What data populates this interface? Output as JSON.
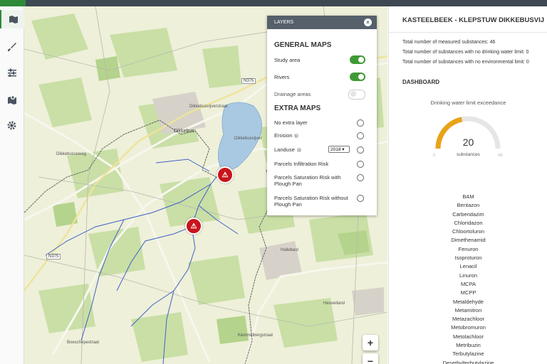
{
  "sidebar": {
    "items": [
      "map-icon",
      "brush-icon",
      "sliders-icon",
      "map-marker-icon",
      "gear-icon"
    ]
  },
  "map": {
    "labels": {
      "village": "Dikkebus",
      "road1": "Dikkebusvijverstraat",
      "road2": "N375",
      "road3": "N375",
      "lake": "Dikkebusvijver",
      "road4": "Heuvelland",
      "road5": "Kemmelbergstraat",
      "road6": "Boeschepestraat",
      "road7": "Hallebast",
      "road8": "Dikkebusseweg"
    },
    "zoom": {
      "in": "+",
      "out": "−"
    }
  },
  "layers": {
    "header": "LAYERS",
    "close": "×",
    "general_title": "GENERAL MAPS",
    "general": [
      {
        "label": "Study area",
        "on": true
      },
      {
        "label": "Rivers",
        "on": true
      },
      {
        "label": "Drainage areas",
        "on": false
      }
    ],
    "extra_title": "EXTRA MAPS",
    "extra": [
      {
        "label": "No extra layer"
      },
      {
        "label": "Erosion"
      },
      {
        "label": "Landuse",
        "select": "2018 ▾"
      },
      {
        "label": "Parcels Infiltration Risk"
      },
      {
        "label": "Parcels Saturation Risk with Plough Pan"
      },
      {
        "label": "Parcels Saturation Risk without Plough Pan"
      }
    ]
  },
  "panel": {
    "title": "KASTEELBEEK - KLEPSTUW DIKKEBUSVIJ",
    "stats": [
      "Total number of measured substances: 46",
      "Total number of substances with no drinking water limit: 0",
      "Total number of substances with no environmental limit: 0"
    ],
    "dashboard_title": "DASHBOARD",
    "gauge": {
      "title": "Drinking water limit exceedance",
      "value": "20",
      "unit": "substances",
      "min": "0",
      "max": "46",
      "fraction": 0.435,
      "color": "#e8a317"
    },
    "substances": [
      "BAM",
      "Bentazon",
      "Carbendazim",
      "Chloridazon",
      "Chloortoluron",
      "Dimethenamid",
      "Fenuron",
      "Isoproturon",
      "Lenacil",
      "Linuron",
      "MCPA",
      "MCPP",
      "Metaldehyde",
      "Metamitron",
      "Metazachloor",
      "Metobromuron",
      "Metolachloor",
      "Metribuzin",
      "Terbutylazine",
      "Desethylterbutylazine"
    ]
  }
}
